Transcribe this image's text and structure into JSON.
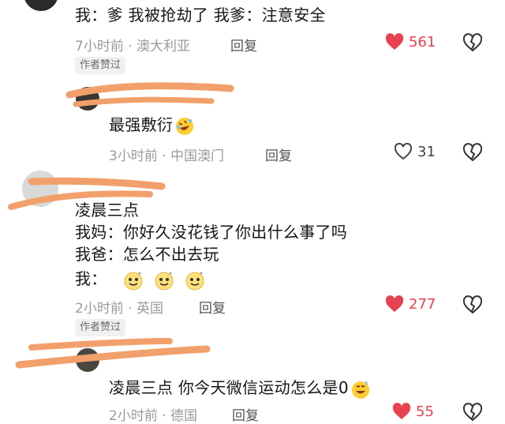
{
  "colors": {
    "like_red": "#e8414f",
    "meta_gray": "#9a9a9a",
    "tag_bg": "#f1f1f1",
    "scribble": "#f2a06b"
  },
  "comments": [
    {
      "text": "我：爹 我被抢劫了 我爹：注意安全",
      "time_location": "7小时前 · 澳大利亚",
      "reply_label": "回复",
      "likes": "561",
      "liked": true,
      "author_tag": "作者赞过"
    },
    {
      "text": "最强敷衍",
      "emoji": "rofl-face-icon",
      "time_location": "3小时前 · 中国澳门",
      "reply_label": "回复",
      "likes": "31",
      "liked": false
    },
    {
      "line1": "凌晨三点",
      "line2": "我妈：你好久没花钱了你出什么事了吗",
      "line3": "我爸：怎么不出去玩",
      "line4": "我：",
      "emojis": [
        "dizzy-smile-icon",
        "dizzy-smile-icon",
        "dizzy-smile-icon"
      ],
      "time_location": "2小时前 · 英国",
      "reply_label": "回复",
      "likes": "277",
      "liked": true,
      "author_tag": "作者赞过"
    },
    {
      "text": "凌晨三点 你今天微信运动怎么是0",
      "emoji": "sweat-smile-icon",
      "time_location": "2小时前 · 德国",
      "reply_label": "回复",
      "likes": "55",
      "liked": true
    }
  ]
}
